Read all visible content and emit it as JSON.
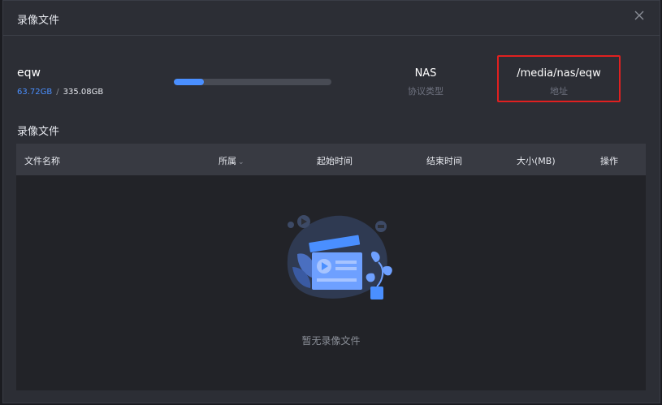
{
  "dialog": {
    "title": "录像文件",
    "close_icon": "close-icon"
  },
  "storage": {
    "name": "eqw",
    "used": "63.72GB",
    "separator": "/",
    "total": "335.08GB",
    "usage_fraction": 0.19,
    "accent_color": "#4a8fff"
  },
  "protocol": {
    "value": "NAS",
    "label": "协议类型"
  },
  "address": {
    "value": "/media/nas/eqw",
    "label": "地址",
    "highlight_color": "#e02020"
  },
  "files_section": {
    "title": "录像文件",
    "columns": [
      {
        "label": "文件名称"
      },
      {
        "label": "所属",
        "sortable": true,
        "icon": "chevron-down-icon"
      },
      {
        "label": "起始时间"
      },
      {
        "label": "结束时间"
      },
      {
        "label": "大小(MB)"
      },
      {
        "label": "操作"
      }
    ],
    "rows": [],
    "empty_text": "暂无录像文件",
    "empty_icon": "empty-video-illustration-icon"
  }
}
